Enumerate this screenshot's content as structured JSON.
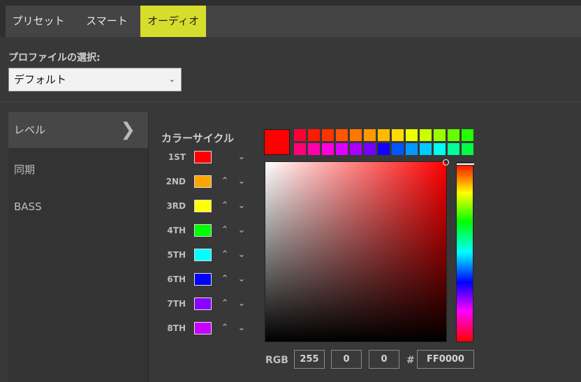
{
  "tabs": [
    {
      "label": "プリセット",
      "active": false
    },
    {
      "label": "スマート",
      "active": false
    },
    {
      "label": "オーディオ",
      "active": true
    }
  ],
  "profile": {
    "label": "プロファイルの選択:",
    "selected": "デフォルト"
  },
  "sidebar": {
    "items": [
      {
        "label": "レベル",
        "active": true
      },
      {
        "label": "同期",
        "active": false
      },
      {
        "label": "BASS",
        "active": false
      }
    ]
  },
  "color_cycle": {
    "title": "カラーサイクル",
    "entries": [
      {
        "label": "1ST",
        "color": "#ff0000"
      },
      {
        "label": "2ND",
        "color": "#ffa500"
      },
      {
        "label": "3RD",
        "color": "#ffff00"
      },
      {
        "label": "4TH",
        "color": "#00ff00"
      },
      {
        "label": "5TH",
        "color": "#00ffff"
      },
      {
        "label": "6TH",
        "color": "#0000ff"
      },
      {
        "label": "7TH",
        "color": "#8b00ff"
      },
      {
        "label": "8TH",
        "color": "#c800ff"
      }
    ]
  },
  "picker": {
    "current_color": "#ff0000",
    "palette_row1": [
      "#ff0033",
      "#ff1a00",
      "#ff3300",
      "#ff5500",
      "#ff7700",
      "#ff9900",
      "#ffbb00",
      "#ffdd00",
      "#eeff00",
      "#ccff00",
      "#99ff00",
      "#66ff00",
      "#22ff00"
    ],
    "palette_row2": [
      "#ff0077",
      "#ff00aa",
      "#ff00dd",
      "#dd00ff",
      "#aa00ff",
      "#7700ff",
      "#1100ff",
      "#0055ff",
      "#0099ff",
      "#00ccff",
      "#00ffee",
      "#00ff99",
      "#00ff44"
    ],
    "hue_color": "#ff0000",
    "hue_fraction": 0.0,
    "saturation": 1.0,
    "brightness": 1.0
  },
  "rgb": {
    "label": "RGB",
    "r": "255",
    "g": "0",
    "b": "0",
    "hash": "#",
    "hex": "FF0000"
  }
}
